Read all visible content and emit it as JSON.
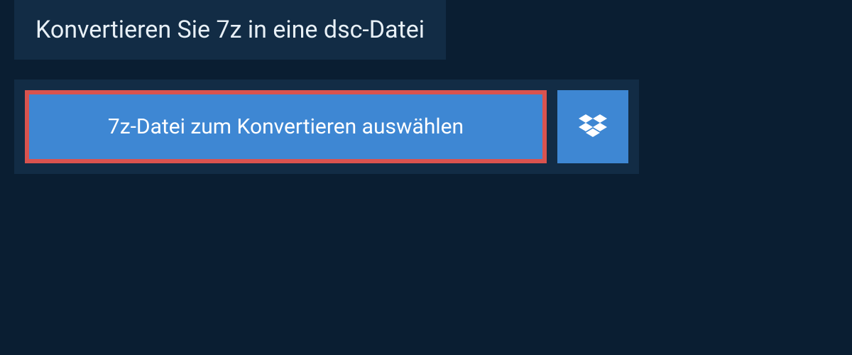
{
  "header": {
    "title": "Konvertieren Sie 7z in eine dsc-Datei"
  },
  "upload": {
    "select_button_label": "7z-Datei zum Konvertieren auswählen",
    "dropbox_icon": "dropbox-icon"
  },
  "colors": {
    "background": "#0a1e32",
    "panel": "#122c45",
    "button": "#3e87d3",
    "highlight_border": "#d9534f",
    "text_light": "#e8f0f6",
    "text_white": "#ffffff"
  }
}
